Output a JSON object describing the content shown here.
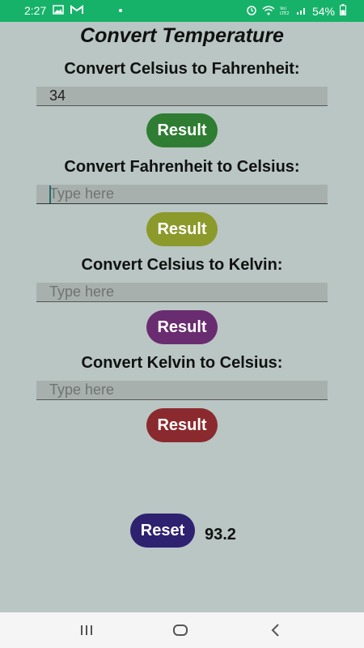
{
  "status_bar": {
    "time": "2:27",
    "battery": "54%"
  },
  "title": "Convert Temperature",
  "sections": [
    {
      "label": "Convert Celsius to Fahrenheit:",
      "value": "34",
      "placeholder": "Type here",
      "button": "Result",
      "button_color": "#2e7d32"
    },
    {
      "label": "Convert Fahrenheit to Celsius:",
      "value": "",
      "placeholder": "Type here",
      "button": "Result",
      "button_color": "#8b9a2a"
    },
    {
      "label": "Convert Celsius to Kelvin:",
      "value": "",
      "placeholder": "Type here",
      "button": "Result",
      "button_color": "#6a2c70"
    },
    {
      "label": "Convert Kelvin to Celsius:",
      "value": "",
      "placeholder": "Type here",
      "button": "Result",
      "button_color": "#8b2a2e"
    }
  ],
  "reset_button": {
    "label": "Reset",
    "color": "#2e2170"
  },
  "result_value": "93.2"
}
